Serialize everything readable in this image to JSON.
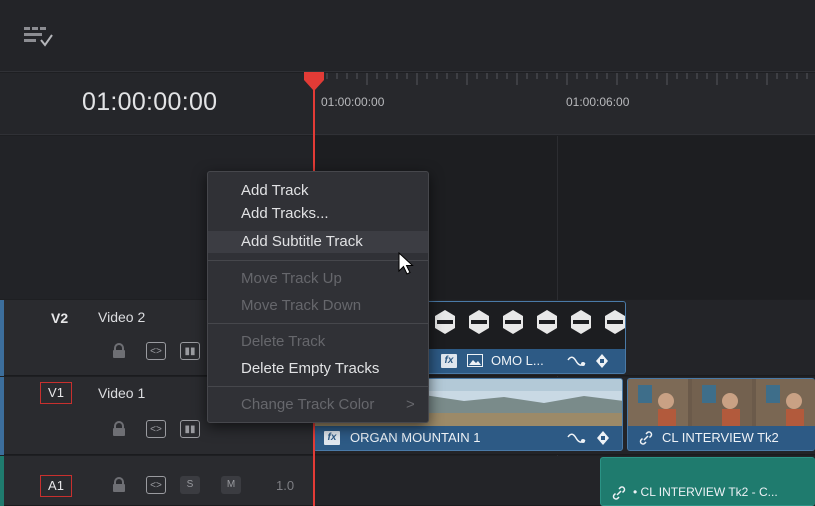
{
  "timeline": {
    "current_timecode": "01:00:00:00",
    "ruler_marks": [
      "01:00:00:00",
      "01:00:06:00"
    ]
  },
  "tracks": [
    {
      "id": "V2",
      "name": "Video 2"
    },
    {
      "id": "V1",
      "name": "Video 1"
    },
    {
      "id": "A1",
      "solo": "S",
      "mute": "M",
      "volume": "1.0"
    }
  ],
  "clips": {
    "v2_clip_label": "OMO L...",
    "v1_clip_a_label": "ORGAN MOUNTAIN 1",
    "v1_clip_b_label": "CL INTERVIEW Tk2",
    "a1_clip_label": "• CL INTERVIEW Tk2 - C...",
    "fx_badge": "fx"
  },
  "context_menu": {
    "items": [
      {
        "label": "Add Track",
        "enabled": true
      },
      {
        "label": "Add Tracks...",
        "enabled": true
      },
      {
        "label": "Add Subtitle Track",
        "enabled": true,
        "highlighted": true
      },
      {
        "label": "Move Track Up",
        "enabled": false
      },
      {
        "label": "Move Track Down",
        "enabled": false
      },
      {
        "label": "Delete Track",
        "enabled": false
      },
      {
        "label": "Delete Empty Tracks",
        "enabled": true
      },
      {
        "label": "Change Track Color",
        "enabled": false,
        "submenu_arrow": ">"
      }
    ]
  },
  "colors": {
    "playhead": "#e23b36",
    "video_clip": "#2f5f8c",
    "audio_clip": "#1f7b6e",
    "track_id_outline": "#c8302e"
  }
}
